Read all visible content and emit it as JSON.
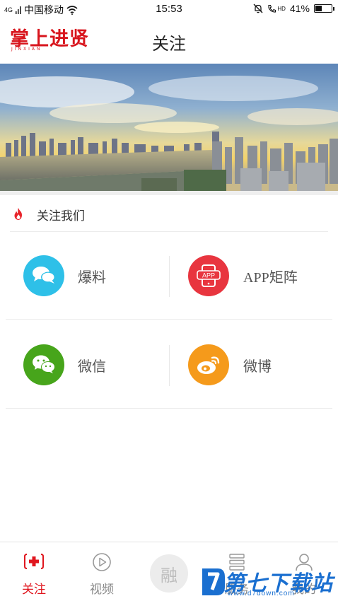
{
  "status_bar": {
    "signal_label": "4G",
    "carrier": "中国移动",
    "time": "15:53",
    "volte": "HD",
    "battery_percent": "41%",
    "battery_level": 0.41
  },
  "header": {
    "logo_text": "掌上进贤",
    "logo_sub": "JINXIAN",
    "title": "关注"
  },
  "banner": {
    "description_colors": {
      "sky_top": "#5d86b8",
      "sunset": "#f3d36a",
      "water": "#8d8a78"
    }
  },
  "section": {
    "title": "关注我们",
    "flame_color": "#e8242b"
  },
  "grid": [
    [
      {
        "label": "爆料",
        "color": "#2ec0e8",
        "icon": "chat-bubbles-icon"
      },
      {
        "label": "APP矩阵",
        "color": "#e8353f",
        "icon": "app-phone-icon",
        "icon_text": "APP"
      }
    ],
    [
      {
        "label": "微信",
        "color": "#47a51b",
        "icon": "wechat-icon"
      },
      {
        "label": "微博",
        "color": "#f59a1b",
        "icon": "weibo-icon"
      }
    ]
  ],
  "tabbar": {
    "tabs": [
      {
        "label": "关注",
        "icon": "medical-cross-icon",
        "active": true
      },
      {
        "label": "视频",
        "icon": "play-circle-icon",
        "active": false
      },
      {
        "label": "融",
        "icon": "center-rong-button",
        "active": false
      },
      {
        "label": "服务",
        "icon": "list-icon",
        "active": false
      },
      {
        "label": "我的",
        "icon": "user-icon",
        "active": false
      }
    ],
    "active_color": "#e0161e",
    "inactive_color": "#888888"
  },
  "watermark": {
    "text": "第七下载站",
    "url": "www.d7down.com",
    "color": "#1a6fd0"
  }
}
